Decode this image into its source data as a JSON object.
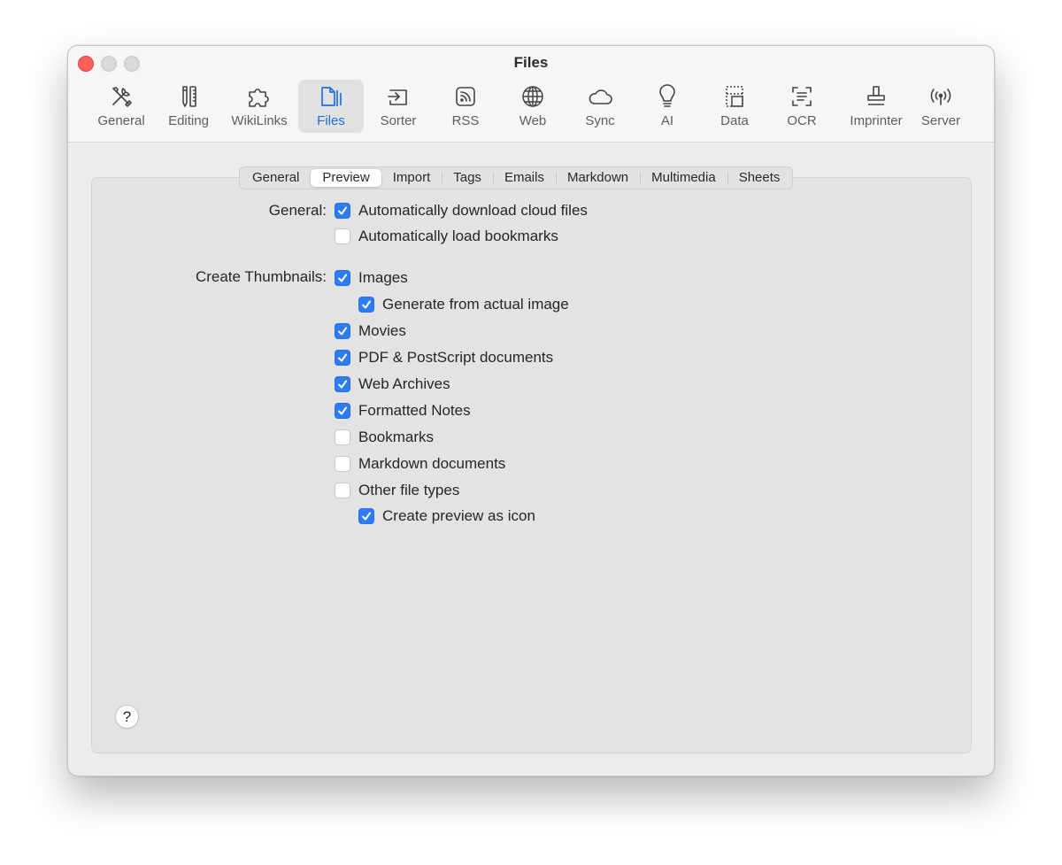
{
  "window": {
    "title": "Files"
  },
  "toolbar": {
    "items": [
      {
        "label": "General",
        "icon": "wrench-screwdriver-icon"
      },
      {
        "label": "Editing",
        "icon": "pencil-ruler-icon"
      },
      {
        "label": "WikiLinks",
        "icon": "puzzle-icon"
      },
      {
        "label": "Files",
        "icon": "files-icon",
        "active": true
      },
      {
        "label": "Sorter",
        "icon": "sorter-icon"
      },
      {
        "label": "RSS",
        "icon": "rss-icon"
      },
      {
        "label": "Web",
        "icon": "globe-icon"
      },
      {
        "label": "Sync",
        "icon": "cloud-icon"
      },
      {
        "label": "AI",
        "icon": "lightbulb-icon"
      },
      {
        "label": "Data",
        "icon": "data-icon"
      },
      {
        "label": "OCR",
        "icon": "ocr-icon"
      },
      {
        "label": "Imprinter",
        "icon": "stamp-icon"
      },
      {
        "label": "Server",
        "icon": "antenna-icon"
      }
    ]
  },
  "tabs": [
    "General",
    "Preview",
    "Import",
    "Tags",
    "Emails",
    "Markdown",
    "Multimedia",
    "Sheets"
  ],
  "selected_tab": "Preview",
  "general": {
    "label": "General:",
    "options": [
      {
        "label": "Automatically download cloud files",
        "checked": true
      },
      {
        "label": "Automatically load bookmarks",
        "checked": false
      }
    ]
  },
  "thumbnails": {
    "label": "Create Thumbnails:",
    "options": [
      {
        "label": "Images",
        "checked": true
      },
      {
        "label": "Generate from actual image",
        "checked": true,
        "indent": true
      },
      {
        "label": "Movies",
        "checked": true
      },
      {
        "label": "PDF & PostScript documents",
        "checked": true
      },
      {
        "label": "Web Archives",
        "checked": true
      },
      {
        "label": "Formatted Notes",
        "checked": true
      },
      {
        "label": "Bookmarks",
        "checked": false
      },
      {
        "label": "Markdown documents",
        "checked": false
      },
      {
        "label": "Other file types",
        "checked": false
      },
      {
        "label": "Create preview as icon",
        "checked": true,
        "indent": true
      }
    ]
  },
  "help": {
    "label": "?"
  },
  "colors": {
    "accent": "#2b7cf6",
    "close": "#fe5f57"
  }
}
